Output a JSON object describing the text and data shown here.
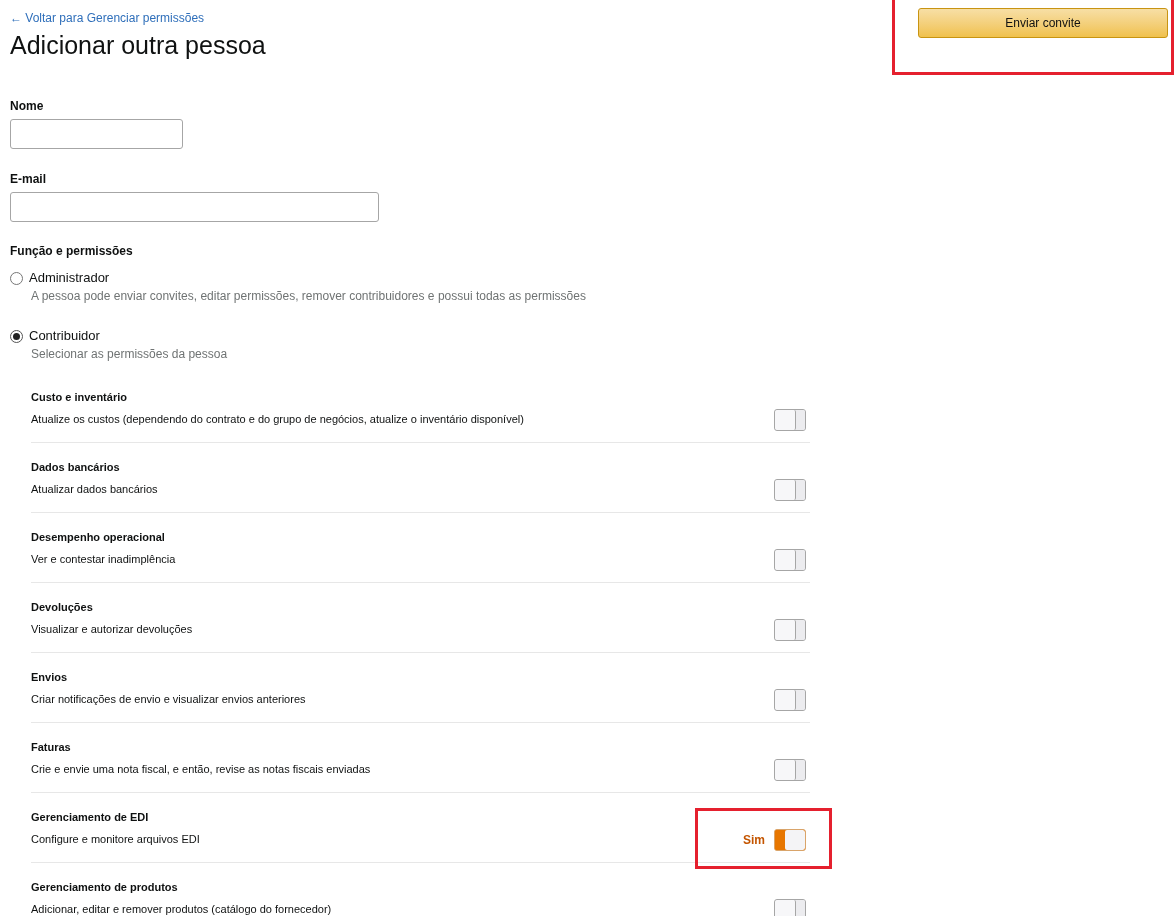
{
  "back_link": "← Voltar para Gerenciar permissões",
  "title": "Adicionar outra pessoa",
  "send_button": {
    "label": "Enviar convite",
    "highlighted": true
  },
  "fields": [
    {
      "label": "Nome"
    },
    {
      "label": "E-mail"
    }
  ],
  "role_section": {
    "heading": "Função e permissões",
    "roles": [
      {
        "label": "Administrador",
        "description": "A pessoa pode enviar convites, editar permissões, remover contribuidores e possui todas as permissões",
        "selected": false
      },
      {
        "label": "Contribuidor",
        "description": "Selecionar as permissões da pessoa",
        "selected": true
      }
    ]
  },
  "permissions": [
    {
      "title": "Custo e inventário",
      "description": "Atualize os custos (dependendo do contrato e do grupo de negócios, atualize o inventário disponível)",
      "on": false,
      "highlighted": false
    },
    {
      "title": "Dados bancários",
      "description": "Atualizar dados bancários",
      "on": false,
      "highlighted": false
    },
    {
      "title": "Desempenho operacional",
      "description": "Ver e contestar inadimplência",
      "on": false,
      "highlighted": false
    },
    {
      "title": "Devoluções",
      "description": "Visualizar e autorizar devoluções",
      "on": false,
      "highlighted": false
    },
    {
      "title": "Envios",
      "description": "Criar notificações de envio e visualizar envios anteriores",
      "on": false,
      "highlighted": false
    },
    {
      "title": "Faturas",
      "description": "Crie e envie uma nota fiscal, e então, revise as notas fiscais enviadas",
      "on": false,
      "highlighted": false
    },
    {
      "title": "Gerenciamento de EDI",
      "description": "Configure e monitore arquivos EDI",
      "on": true,
      "on_label": "Sim",
      "highlighted": true
    },
    {
      "title": "Gerenciamento de produtos",
      "description": "Adicionar, editar e remover produtos (catálogo do fornecedor)",
      "on": false,
      "highlighted": false
    }
  ]
}
